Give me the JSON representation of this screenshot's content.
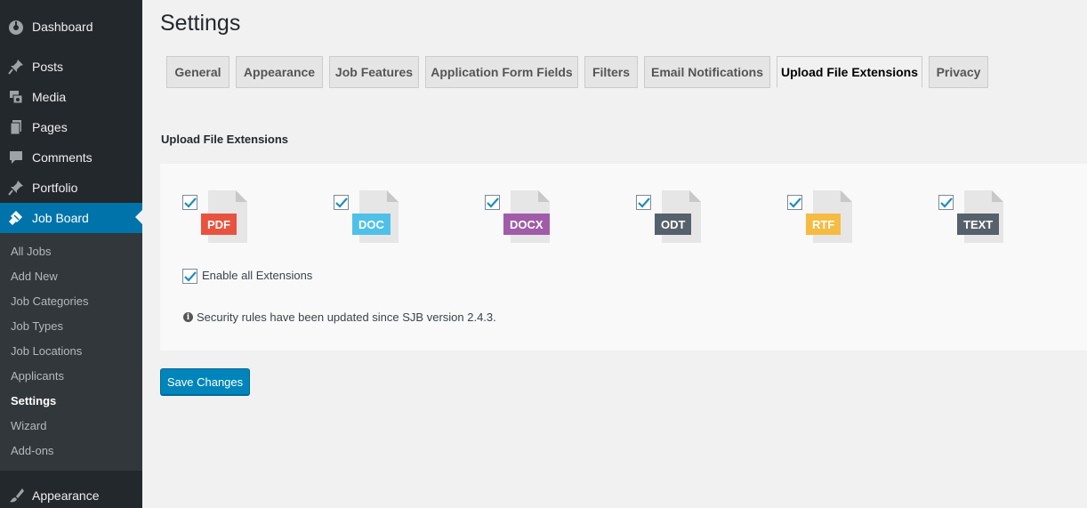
{
  "sidebar": {
    "items": [
      {
        "label": "Dashboard",
        "icon": "dashboard-icon"
      },
      {
        "label": "Posts",
        "icon": "pin-icon"
      },
      {
        "label": "Media",
        "icon": "media-icon"
      },
      {
        "label": "Pages",
        "icon": "pages-icon"
      },
      {
        "label": "Comments",
        "icon": "comment-icon"
      },
      {
        "label": "Portfolio",
        "icon": "pin-icon"
      },
      {
        "label": "Job Board",
        "icon": "job-board-icon"
      },
      {
        "label": "Appearance",
        "icon": "brush-icon"
      }
    ],
    "submenu": [
      "All Jobs",
      "Add New",
      "Job Categories",
      "Job Types",
      "Job Locations",
      "Applicants",
      "Settings",
      "Wizard",
      "Add-ons"
    ]
  },
  "page": {
    "title": "Settings",
    "tabs": [
      "General",
      "Appearance",
      "Job Features",
      "Application Form Fields",
      "Filters",
      "Email Notifications",
      "Upload File Extensions",
      "Privacy"
    ],
    "active_tab": "Upload File Extensions",
    "section_title": "Upload File Extensions",
    "extensions": [
      {
        "label": "PDF",
        "color": "#e8533f",
        "checked": true
      },
      {
        "label": "DOC",
        "color": "#4fc1e9",
        "checked": true
      },
      {
        "label": "DOCX",
        "color": "#a05ca8",
        "checked": true
      },
      {
        "label": "ODT",
        "color": "#56616b",
        "checked": true
      },
      {
        "label": "RTF",
        "color": "#f6bb42",
        "checked": true
      },
      {
        "label": "TEXT",
        "color": "#56616b",
        "checked": true
      }
    ],
    "enable_all_label": "Enable all Extensions",
    "enable_all_checked": true,
    "security_note": "Security rules have been updated since SJB version 2.4.3.",
    "save_label": "Save Changes"
  },
  "colors": {
    "sidebar_bg": "#23282d",
    "submenu_bg": "#32373c",
    "accent": "#0073aa",
    "button": "#0085ba",
    "checkmark": "#1e8cbe"
  }
}
